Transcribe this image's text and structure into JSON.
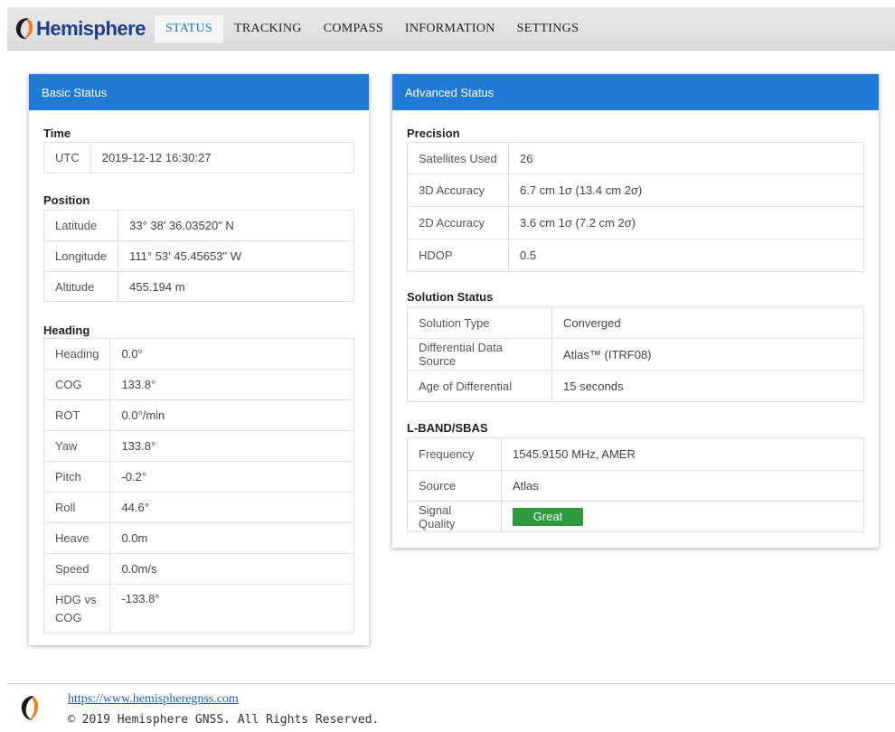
{
  "brand": {
    "name": "Hemisphere",
    "accent": "#1f7ad8"
  },
  "nav": [
    {
      "label": "STATUS",
      "active": true
    },
    {
      "label": "TRACKING"
    },
    {
      "label": "COMPASS"
    },
    {
      "label": "INFORMATION"
    },
    {
      "label": "SETTINGS"
    }
  ],
  "basic": {
    "title": "Basic Status",
    "time": {
      "title": "Time",
      "label": "UTC",
      "value": "2019-12-12 16:30:27"
    },
    "position": {
      "title": "Position",
      "rows": [
        {
          "label": "Latitude",
          "value": "33° 38' 36.03520\" N"
        },
        {
          "label": "Longitude",
          "value": "111° 53' 45.45653\" W"
        },
        {
          "label": "Altitude",
          "value": "455.194 m"
        }
      ]
    },
    "heading": {
      "title": "Heading",
      "rows": [
        {
          "label": "Heading",
          "value": "0.0°"
        },
        {
          "label": "COG",
          "value": "133.8°"
        },
        {
          "label": "ROT",
          "value": "0.0°/min"
        },
        {
          "label": "Yaw",
          "value": "133.8°"
        },
        {
          "label": "Pitch",
          "value": "-0.2°"
        },
        {
          "label": "Roll",
          "value": "44.6°"
        },
        {
          "label": "Heave",
          "value": "0.0m"
        },
        {
          "label": "Speed",
          "value": "0.0m/s"
        },
        {
          "label": "HDG vs COG",
          "value": "-133.8°"
        }
      ]
    }
  },
  "advanced": {
    "title": "Advanced Status",
    "precision": {
      "title": "Precision",
      "rows": [
        {
          "label": "Satellites Used",
          "value": "26"
        },
        {
          "label": "3D Accuracy",
          "value": "6.7 cm 1σ (13.4 cm 2σ)"
        },
        {
          "label": "2D Accuracy",
          "value": "3.6 cm 1σ (7.2 cm 2σ)"
        },
        {
          "label": "HDOP",
          "value": "0.5"
        }
      ]
    },
    "solution": {
      "title": "Solution Status",
      "rows": [
        {
          "label": "Solution Type",
          "value": "Converged"
        },
        {
          "label": "Differential Data Source",
          "value": "Atlas™ (ITRF08)"
        },
        {
          "label": "Age of Differential",
          "value": "15 seconds"
        }
      ]
    },
    "lband": {
      "title": "L-BAND/SBAS",
      "rows": [
        {
          "label": "Frequency",
          "value": "1545.9150 MHz, AMER"
        },
        {
          "label": "Source",
          "value": "Atlas"
        },
        {
          "label": "Signal Quality",
          "value": "Great",
          "color": "#2e9b3c"
        }
      ]
    }
  },
  "footer": {
    "link": "https://www.hemispheregnss.com",
    "copyright": "© 2019 Hemisphere GNSS. All Rights Reserved."
  }
}
